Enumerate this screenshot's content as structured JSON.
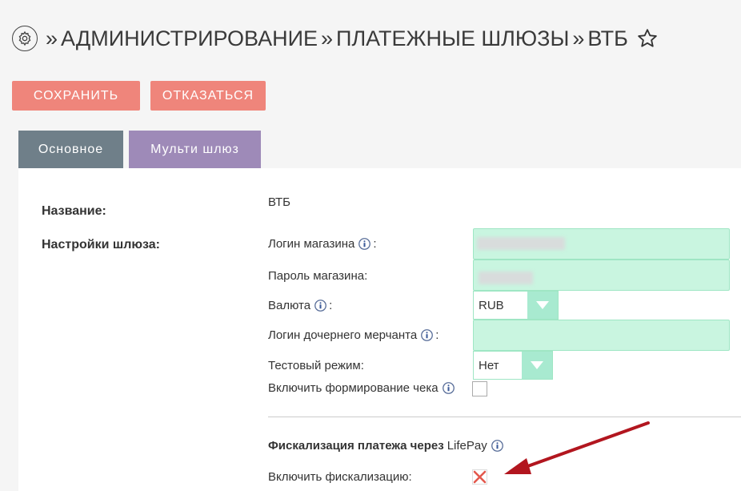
{
  "header": {
    "breadcrumbs": [
      "АДМИНИСТРИРОВАНИЕ",
      "ПЛАТЕЖНЫЕ ШЛЮЗЫ",
      "ВТБ"
    ],
    "separator": "»"
  },
  "toolbar": {
    "save_label": "СОХРАНИТЬ",
    "cancel_label": "ОТКАЗАТЬСЯ"
  },
  "tabs": [
    {
      "label": "Основное",
      "active": true
    },
    {
      "label": "Мульти шлюз",
      "active": false
    }
  ],
  "form": {
    "name_label": "Название:",
    "name_value": "ВТБ",
    "settings_label": "Настройки шлюза:",
    "fields": {
      "shop_login": {
        "label": "Логин магазина",
        "colon": ":"
      },
      "shop_password": {
        "label": "Пароль магазина:"
      },
      "currency": {
        "label": "Валюта",
        "colon": ":",
        "value": "RUB"
      },
      "sub_merchant_login": {
        "label": "Логин дочернего мерчанта",
        "colon": ":"
      },
      "test_mode": {
        "label": "Тестовый режим:",
        "value": "Нет"
      },
      "receipt": {
        "label": "Включить формирование чека"
      }
    },
    "fiscal": {
      "title": "Фискализация платежа через",
      "brand": "LifePay",
      "enable_label": "Включить фискализацию:",
      "enabled": false
    }
  },
  "colors": {
    "button": "#ef857b",
    "tab_active": "#6f7f89",
    "tab_inactive": "#9e8ab8",
    "field_bg": "#c9f5e0",
    "arrow_annotation": "#b2161f"
  }
}
